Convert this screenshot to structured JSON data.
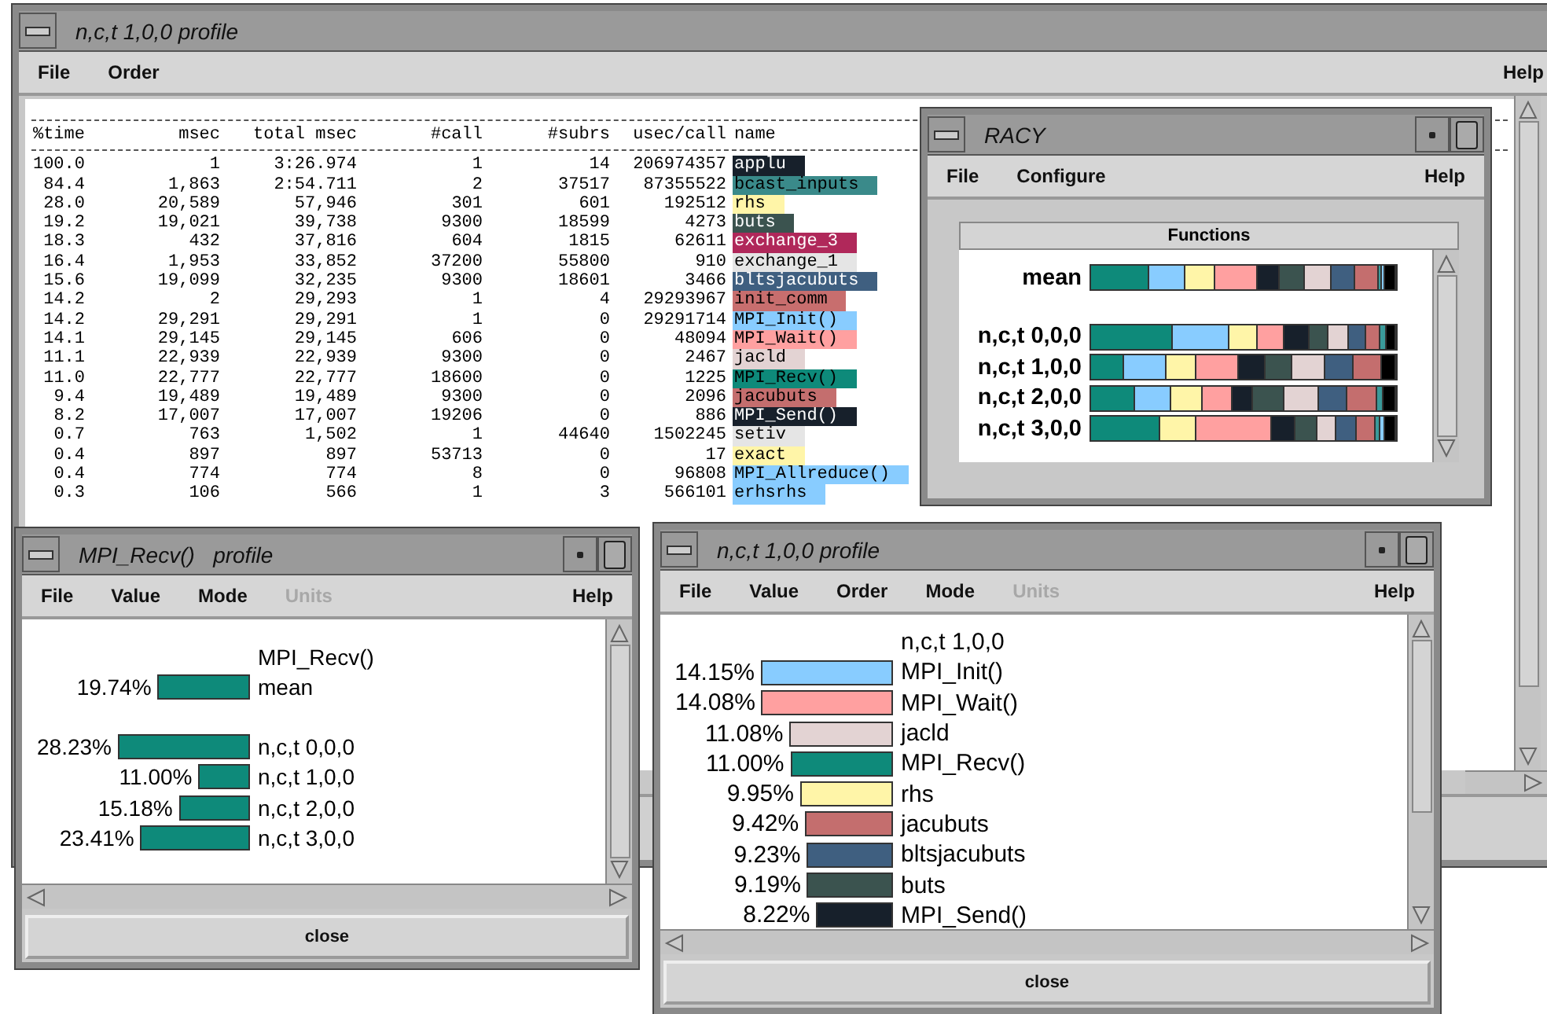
{
  "main_window": {
    "title": "n,c,t 1,0,0 profile",
    "menu": [
      {
        "label": "File",
        "disabled": false
      },
      {
        "label": "Order",
        "disabled": false
      },
      {
        "label": "Help",
        "disabled": false
      }
    ],
    "table": {
      "columns": [
        "%time",
        "msec",
        "total msec",
        "#call",
        "#subrs",
        "usec/call",
        "name"
      ],
      "rows": [
        {
          "cells": [
            "100.0",
            "1",
            "3:26.974",
            "1",
            "14",
            "206974357"
          ],
          "name": "applu",
          "color": "#17202b"
        },
        {
          "cells": [
            "84.4",
            "1,863",
            "2:54.711",
            "2",
            "37517",
            "87355522"
          ],
          "name": "bcast_inputs",
          "color": "#3a8a8a"
        },
        {
          "cells": [
            "28.0",
            "20,589",
            "57,946",
            "301",
            "601",
            "192512"
          ],
          "name": "rhs",
          "color": "#fff5a8"
        },
        {
          "cells": [
            "19.2",
            "19,021",
            "39,738",
            "9300",
            "18599",
            "4273"
          ],
          "name": "buts",
          "color": "#3b534f"
        },
        {
          "cells": [
            "18.3",
            "432",
            "37,816",
            "604",
            "1815",
            "62611"
          ],
          "name": "exchange_3",
          "color": "#b0285a"
        },
        {
          "cells": [
            "16.4",
            "1,953",
            "33,852",
            "37200",
            "55800",
            "910"
          ],
          "name": "exchange_1",
          "color": "#e5e5e5"
        },
        {
          "cells": [
            "15.6",
            "19,099",
            "32,235",
            "9300",
            "18601",
            "3466"
          ],
          "name": "bltsjacubuts",
          "color": "#3f5f80"
        },
        {
          "cells": [
            "14.2",
            "2",
            "29,293",
            "1",
            "4",
            "29293967"
          ],
          "name": "init_comm",
          "color": "#c86e6e"
        },
        {
          "cells": [
            "14.2",
            "29,291",
            "29,291",
            "1",
            "0",
            "29291714"
          ],
          "name": "MPI_Init()",
          "color": "#88ccff"
        },
        {
          "cells": [
            "14.1",
            "29,145",
            "29,145",
            "606",
            "0",
            "48094"
          ],
          "name": "MPI_Wait()",
          "color": "#ffa0a0"
        },
        {
          "cells": [
            "11.1",
            "22,939",
            "22,939",
            "9300",
            "0",
            "2467"
          ],
          "name": "jacld",
          "color": "#e3d3d3"
        },
        {
          "cells": [
            "11.0",
            "22,777",
            "22,777",
            "18600",
            "0",
            "1225"
          ],
          "name": "MPI_Recv()",
          "color": "#0e8a7a"
        },
        {
          "cells": [
            "9.4",
            "19,489",
            "19,489",
            "9300",
            "0",
            "2096"
          ],
          "name": "jacubuts",
          "color": "#c46e6e"
        },
        {
          "cells": [
            "8.2",
            "17,007",
            "17,007",
            "19206",
            "0",
            "886"
          ],
          "name": "MPI_Send()",
          "color": "#17202b"
        },
        {
          "cells": [
            "0.7",
            "763",
            "1,502",
            "1",
            "44640",
            "1502245"
          ],
          "name": "setiv",
          "color": "#e5e5e5"
        },
        {
          "cells": [
            "0.4",
            "897",
            "897",
            "53713",
            "0",
            "17"
          ],
          "name": "exact",
          "color": "#fff5a8"
        },
        {
          "cells": [
            "0.4",
            "774",
            "774",
            "8",
            "0",
            "96808"
          ],
          "name": "MPI_Allreduce()",
          "color": "#88ccff"
        },
        {
          "cells": [
            "0.3",
            "106",
            "566",
            "1",
            "3",
            "566101"
          ],
          "name": "erhsrhs",
          "color": "#88ccff"
        }
      ]
    }
  },
  "racy_window": {
    "title": "RACY",
    "menu": [
      {
        "label": "File",
        "disabled": false
      },
      {
        "label": "Configure",
        "disabled": false
      },
      {
        "label": "Help",
        "disabled": false
      }
    ],
    "panel_title": "Functions",
    "rows": [
      {
        "label": "mean"
      },
      {
        "label": "n,c,t 0,0,0"
      },
      {
        "label": "n,c,t 1,0,0"
      },
      {
        "label": "n,c,t 2,0,0"
      },
      {
        "label": "n,c,t 3,0,0"
      }
    ]
  },
  "function_window": {
    "title": "MPI_Recv()   profile",
    "menu": [
      {
        "label": "File",
        "disabled": false
      },
      {
        "label": "Value",
        "disabled": false
      },
      {
        "label": "Mode",
        "disabled": false
      },
      {
        "label": "Units",
        "disabled": true
      },
      {
        "label": "Help",
        "disabled": false
      }
    ],
    "heading": "MPI_Recv()",
    "rows": [
      {
        "percent": "19.74%",
        "label": "mean",
        "level": 0.699
      },
      {
        "percent": "28.23%",
        "label": "n,c,t 0,0,0",
        "level": 1
      },
      {
        "percent": "11.00%",
        "label": "n,c,t 1,0,0",
        "level": 0.39
      },
      {
        "percent": "15.18%",
        "label": "n,c,t 2,0,0",
        "level": 0.538
      },
      {
        "percent": "23.41%",
        "label": "n,c,t 3,0,0",
        "level": 0.829
      }
    ],
    "button": "close"
  },
  "node_window": {
    "title": "n,c,t 1,0,0 profile",
    "menu": [
      {
        "label": "File",
        "disabled": false
      },
      {
        "label": "Value",
        "disabled": false
      },
      {
        "label": "Order",
        "disabled": false
      },
      {
        "label": "Mode",
        "disabled": false
      },
      {
        "label": "Units",
        "disabled": true
      },
      {
        "label": "Help",
        "disabled": false
      }
    ],
    "heading": "n,c,t 1,0,0",
    "rows": [
      {
        "percent": "14.15%",
        "label": "MPI_Init()",
        "color": "#88ccff",
        "level": 1
      },
      {
        "percent": "14.08%",
        "label": "MPI_Wait()",
        "color": "#ffa0a0",
        "level": 0.995
      },
      {
        "percent": "11.08%",
        "label": "jacld",
        "color": "#e3d3d3",
        "level": 0.783
      },
      {
        "percent": "11.00%",
        "label": "MPI_Recv()",
        "color": "#0e8a7a",
        "level": 0.777
      },
      {
        "percent": "9.95%",
        "label": "rhs",
        "color": "#fff5a8",
        "level": 0.703
      },
      {
        "percent": "9.42%",
        "label": "jacubuts",
        "color": "#c46e6e",
        "level": 0.666
      },
      {
        "percent": "9.23%",
        "label": "bltsjacubuts",
        "color": "#3f5f80",
        "level": 0.652
      },
      {
        "percent": "9.19%",
        "label": "buts",
        "color": "#3b534f",
        "level": 0.649
      },
      {
        "percent": "8.22%",
        "label": "MPI_Send()",
        "color": "#17202b",
        "level": 0.581
      }
    ],
    "button": "close"
  }
}
